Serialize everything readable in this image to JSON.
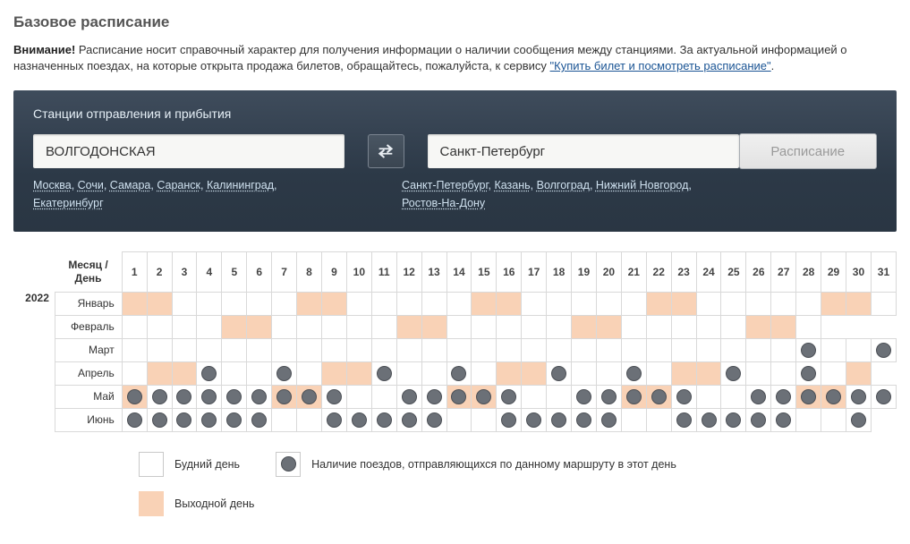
{
  "pageTitle": "Базовое расписание",
  "notice": {
    "strong": "Внимание!",
    "text1": " Расписание носит справочный характер для получения информации о наличии сообщения между станциями. За актуальной информацией о назначенных поездах, на которые открыта продажа билетов, обращайтесь, пожалуйста, к сервису ",
    "link": "\"Купить билет и посмотреть расписание\"",
    "text2": "."
  },
  "panel": {
    "title": "Станции отправления и прибытия",
    "from": "ВОЛГОДОНСКАЯ",
    "to": "Санкт-Петербург",
    "button": "Расписание",
    "fromCities": [
      "Москва",
      "Сочи",
      "Самара",
      "Саранск",
      "Калининград",
      "Екатеринбург"
    ],
    "toCities": [
      "Санкт-Петербург",
      "Казань",
      "Волгоград",
      "Нижний Новгород",
      "Ростов-На-Дону"
    ]
  },
  "calendar": {
    "cornerLabel": "Месяц / День",
    "year": "2022",
    "days": [
      "1",
      "2",
      "3",
      "4",
      "5",
      "6",
      "7",
      "8",
      "9",
      "10",
      "11",
      "12",
      "13",
      "14",
      "15",
      "16",
      "17",
      "18",
      "19",
      "20",
      "21",
      "22",
      "23",
      "24",
      "25",
      "26",
      "27",
      "28",
      "29",
      "30",
      "31"
    ],
    "months": [
      {
        "name": "Январь",
        "len": 31,
        "weekends": [
          1,
          2,
          8,
          9,
          15,
          16,
          22,
          23,
          29,
          30
        ],
        "trains": []
      },
      {
        "name": "Февраль",
        "len": 28,
        "weekends": [
          5,
          6,
          12,
          13,
          19,
          20,
          26,
          27
        ],
        "trains": []
      },
      {
        "name": "Март",
        "len": 31,
        "weekends": [],
        "trains": [
          28,
          31
        ]
      },
      {
        "name": "Апрель",
        "len": 30,
        "weekends": [
          2,
          3,
          9,
          10,
          16,
          17,
          23,
          24,
          30
        ],
        "trains": [
          4,
          7,
          11,
          14,
          18,
          21,
          25,
          28
        ]
      },
      {
        "name": "Май",
        "len": 31,
        "weekends": [
          1,
          7,
          8,
          14,
          15,
          21,
          22,
          28,
          29
        ],
        "trains": [
          1,
          2,
          3,
          4,
          5,
          6,
          7,
          8,
          9,
          12,
          13,
          14,
          15,
          16,
          19,
          20,
          21,
          22,
          23,
          26,
          27,
          28,
          29,
          30,
          31
        ]
      },
      {
        "name": "Июнь",
        "len": 30,
        "weekends": [],
        "trains": [
          1,
          2,
          3,
          4,
          5,
          6,
          9,
          10,
          11,
          12,
          13,
          16,
          17,
          18,
          19,
          20,
          23,
          24,
          25,
          26,
          27,
          30
        ]
      }
    ]
  },
  "legend": {
    "weekday": "Будний день",
    "weekend": "Выходной день",
    "train": "Наличие поездов, отправляющихся по данному маршруту в этот день"
  }
}
